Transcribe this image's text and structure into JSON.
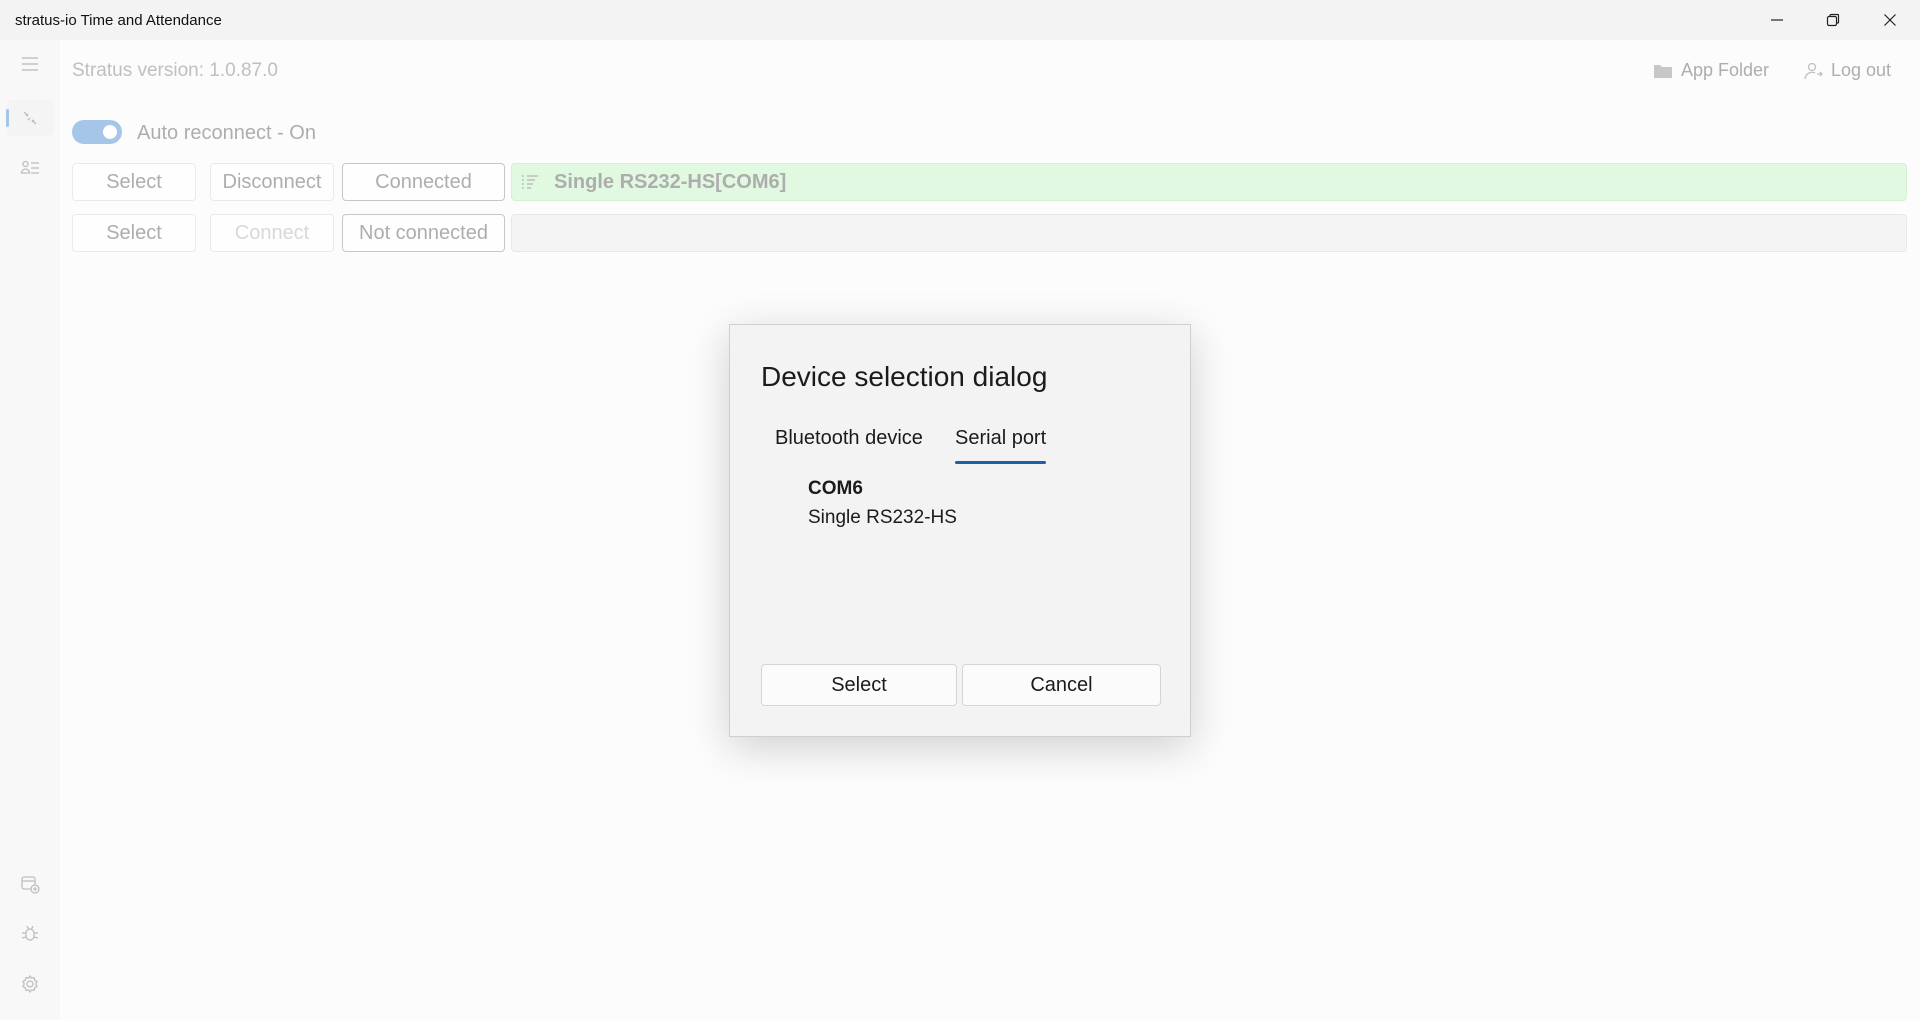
{
  "window": {
    "title": "stratus-io Time and Attendance"
  },
  "header": {
    "version_text": "Stratus version: 1.0.87.0",
    "app_folder_label": "App Folder",
    "logout_label": "Log out"
  },
  "auto_reconnect": {
    "label": "Auto reconnect - On",
    "enabled": true
  },
  "devices": [
    {
      "select_label": "Select",
      "action_label": "Disconnect",
      "status_label": "Connected",
      "device_name": "Single RS232-HS[COM6]",
      "status_color": "#c9f2c8"
    },
    {
      "select_label": "Select",
      "action_label": "Connect",
      "status_label": "Not connected",
      "device_name": "",
      "status_color": "#ececec"
    }
  ],
  "dialog": {
    "title": "Device selection dialog",
    "tabs": [
      {
        "label": "Bluetooth device",
        "active": false
      },
      {
        "label": "Serial port",
        "active": true
      }
    ],
    "ports": [
      {
        "name": "COM6",
        "description": "Single RS232-HS"
      }
    ],
    "select_label": "Select",
    "cancel_label": "Cancel"
  },
  "sidebar": {
    "top_items": [
      {
        "icon": "connection-icon",
        "active": true
      },
      {
        "icon": "user-list-icon",
        "active": false
      }
    ],
    "bottom_items": [
      {
        "icon": "calendar-add-icon"
      },
      {
        "icon": "bug-icon"
      },
      {
        "icon": "settings-gear-icon"
      }
    ]
  },
  "colors": {
    "accent": "#5b97d6",
    "tab_underline": "#1f5fa8",
    "connected_bg": "#c9f2c8"
  }
}
